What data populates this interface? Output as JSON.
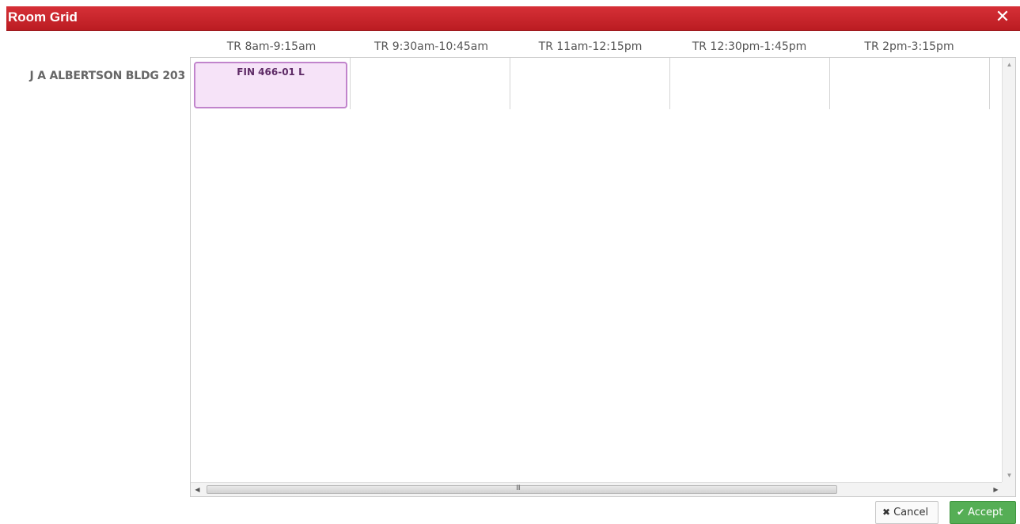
{
  "dialog": {
    "title": "Room Grid",
    "close_glyph": "✕"
  },
  "grid": {
    "columns": [
      "TR 8am-9:15am",
      "TR 9:30am-10:45am",
      "TR 11am-12:15pm",
      "TR 12:30pm-1:45pm",
      "TR 2pm-3:15pm"
    ],
    "rows": [
      {
        "room": "J A ALBERTSON BLDG 203",
        "courses": [
          "FIN 466-01 L",
          "",
          "",
          "",
          ""
        ]
      }
    ]
  },
  "scrollbar": {
    "up_glyph": "▲",
    "down_glyph": "▼",
    "left_glyph": "◀",
    "right_glyph": "▶",
    "grip": "III"
  },
  "buttons": {
    "cancel_icon": "✖",
    "cancel_label": "Cancel",
    "accept_icon": "✔",
    "accept_label": "Accept"
  },
  "colors": {
    "title_bar": "#c8232a",
    "course_fill": "#f6e3f8",
    "course_border": "#c184cc",
    "accept_button": "#55ae55"
  },
  "icons": {
    "close": "close-icon",
    "cancel": "times-icon",
    "accept": "check-icon"
  }
}
